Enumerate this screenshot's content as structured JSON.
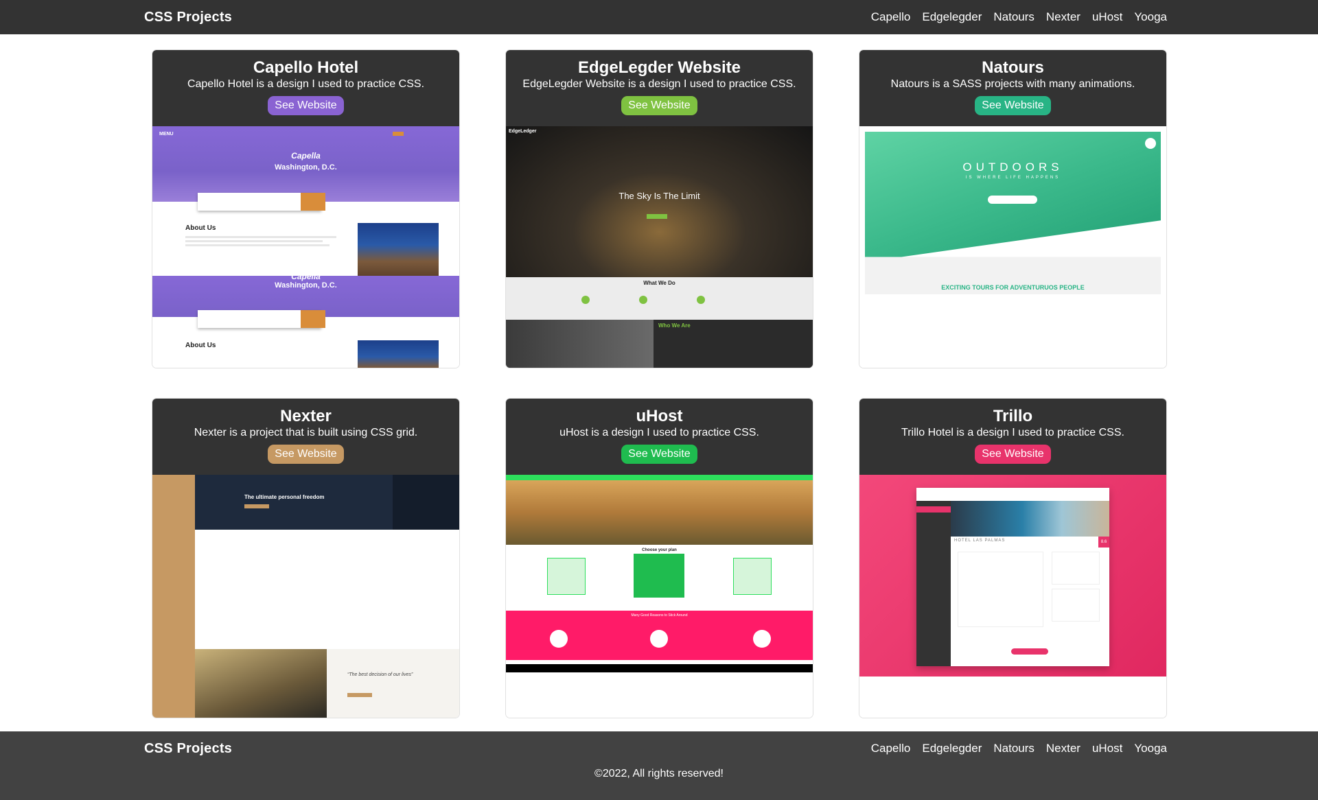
{
  "navbar": {
    "brand": "CSS Projects",
    "links": [
      "Capello",
      "Edgelegder",
      "Natours",
      "Nexter",
      "uHost",
      "Yooga"
    ]
  },
  "cards": [
    {
      "title": "Capello Hotel",
      "description": "Capello Hotel is a design I used to practice CSS.",
      "button": "See Website",
      "button_color": "#8a63d2",
      "preview": {
        "hero_title": "Capella",
        "hero_subtitle": "Washington, D.C.",
        "section_title": "About Us",
        "menu": "MENU"
      }
    },
    {
      "title": "EdgeLegder Website",
      "description": "EdgeLegder Website is a design I used to practice CSS.",
      "button": "See Website",
      "button_color": "#7fc241",
      "preview": {
        "hero_title": "The Sky Is The Limit",
        "section1": "What We Do",
        "section2": "Who We Are",
        "logo": "EdgeLedger"
      }
    },
    {
      "title": "Natours",
      "description": "Natours is a SASS projects with many animations.",
      "button": "See Website",
      "button_color": "#28b485",
      "preview": {
        "hero_title": "OUTDOORS",
        "hero_subtitle": "IS WHERE LIFE HAPPENS",
        "tagline": "EXCITING TOURS FOR ADVENTURUOS PEOPLE"
      }
    },
    {
      "title": "Nexter",
      "description": "Nexter is a project that is built using CSS grid.",
      "button": "See Website",
      "button_color": "#c69963",
      "preview": {
        "hero_title": "The ultimate personal freedom",
        "quote": "“The best decision of our lives”"
      }
    },
    {
      "title": "uHost",
      "description": "uHost is a design I used to practice CSS.",
      "button": "See Website",
      "button_color": "#1fbc4f",
      "preview": {
        "plans_title": "Choose your plan",
        "band_title": "Many Good Reasons to Stick Around"
      }
    },
    {
      "title": "Trillo",
      "description": "Trillo Hotel is a design I used to practice CSS.",
      "button": "See Website",
      "button_color": "#e8336b",
      "preview": {
        "hotel_name": "HOTEL LAS PALMAS",
        "rating": "8.6"
      }
    }
  ],
  "footer": {
    "brand": "CSS Projects",
    "links": [
      "Capello",
      "Edgelegder",
      "Natours",
      "Nexter",
      "uHost",
      "Yooga"
    ],
    "copyright": "©2022, All rights reserved!"
  }
}
